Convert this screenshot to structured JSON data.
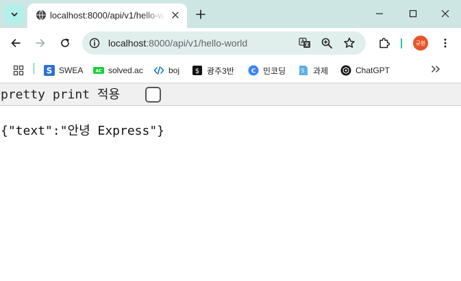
{
  "tab": {
    "title": "localhost:8000/api/v1/hello-world"
  },
  "omnibox": {
    "host": "localhost",
    "path": ":8000/api/v1/hello-world"
  },
  "profile": {
    "avatar_text": "규환",
    "color": "#e8542a"
  },
  "bookmarks": [
    {
      "label": "SWEA",
      "icon": "swea-icon"
    },
    {
      "label": "solved.ac",
      "icon": "solvedac-icon"
    },
    {
      "label": "boj",
      "icon": "code-icon"
    },
    {
      "label": "광주3반",
      "icon": "notion-icon"
    },
    {
      "label": "민코딩",
      "icon": "mincoding-icon"
    },
    {
      "label": "과제",
      "icon": "doc-icon"
    },
    {
      "label": "ChatGPT",
      "icon": "chatgpt-icon"
    }
  ],
  "page": {
    "pretty_print_label": "pretty print 적용",
    "pretty_print_checked": false,
    "json_output": "{\"text\":\"안녕 Express\"}"
  },
  "colors": {
    "accent": "#2fbba6",
    "titlebar": "#cde6e3",
    "omnibox": "#e1efec"
  }
}
